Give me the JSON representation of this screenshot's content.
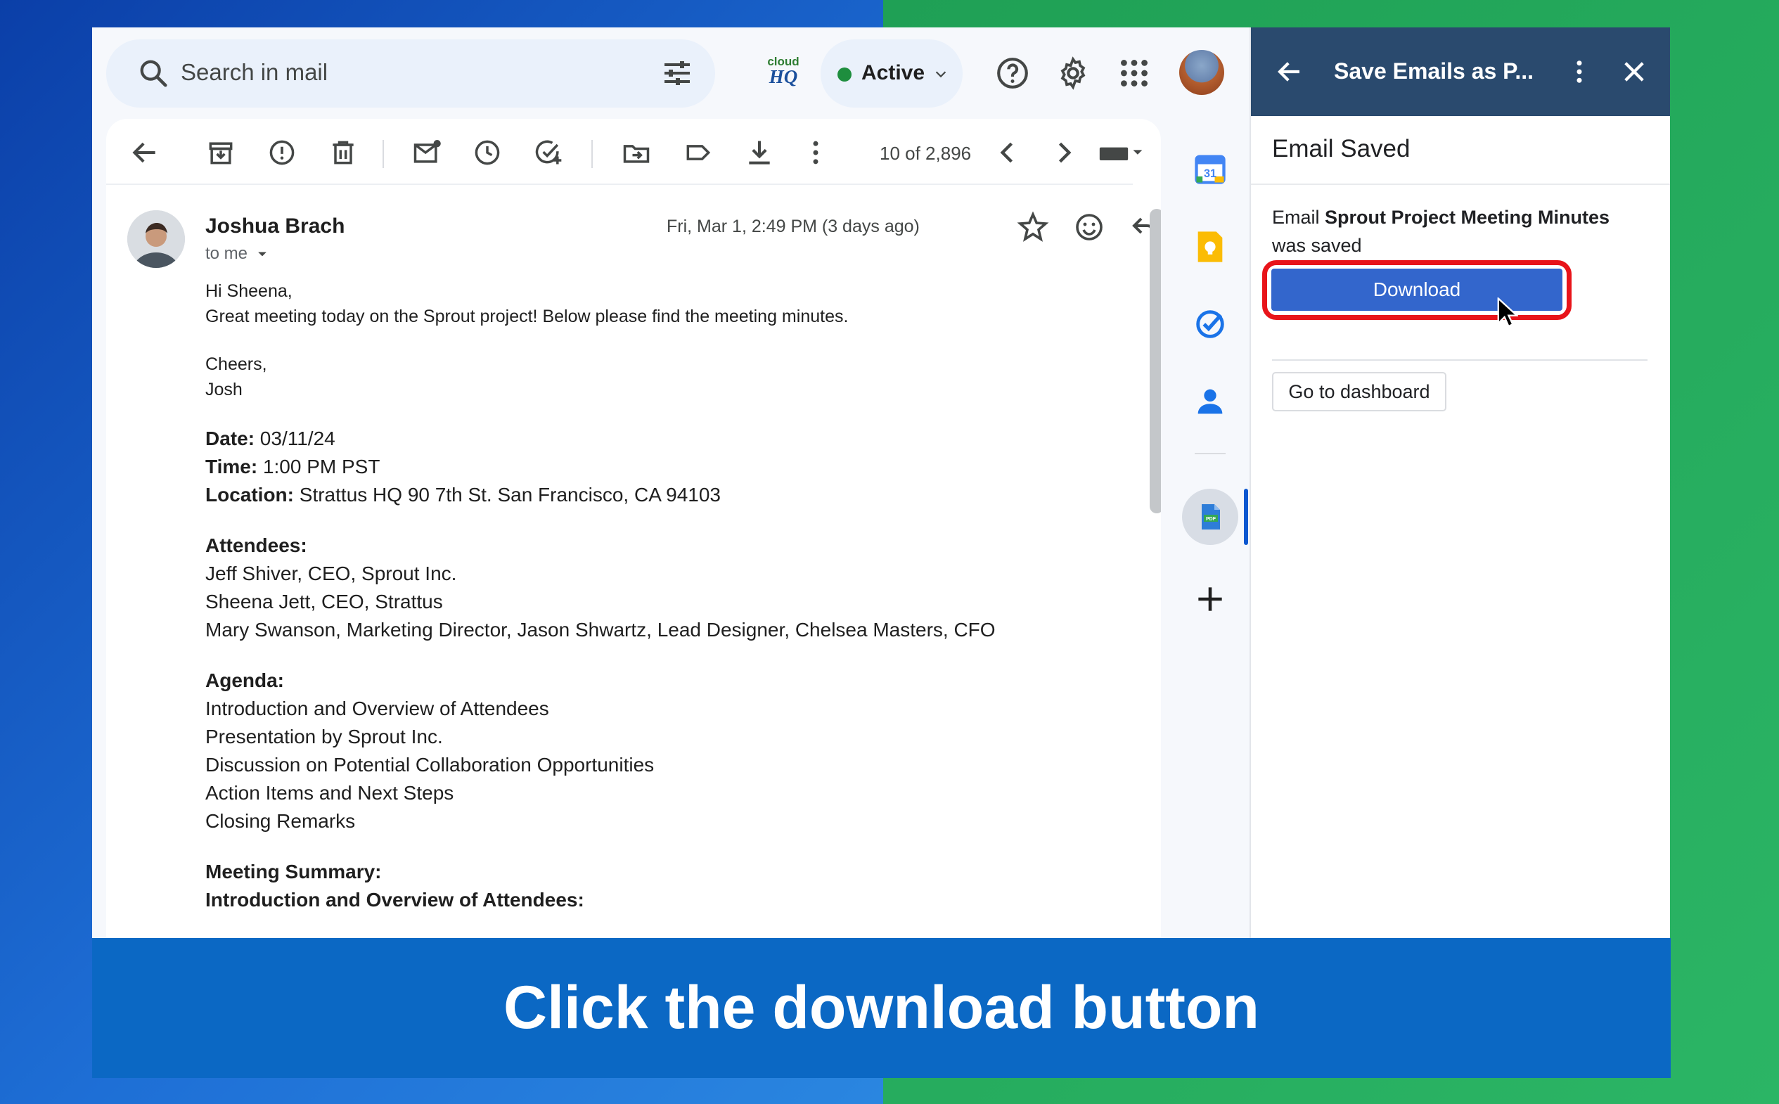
{
  "search": {
    "placeholder": "Search in mail"
  },
  "cloudhq": {
    "top": "cloud",
    "bottom": "HQ"
  },
  "status": {
    "label": "Active",
    "color": "#1e8e3e"
  },
  "toolbar": {
    "count": "10 of 2,896"
  },
  "email": {
    "sender": "Joshua Brach",
    "to": "to me",
    "date": "Fri, Mar 1, 2:49 PM (3 days ago)",
    "greeting": "Hi Sheena,",
    "intro": "Great meeting today on the Sprout project! Below please find the meeting minutes.",
    "signoff": "Cheers,",
    "signature": "Josh",
    "date_label": "Date:",
    "date_value": " 03/11/24",
    "time_label": "Time:",
    "time_value": " 1:00 PM PST",
    "location_label": "Location:",
    "location_value": " Strattus HQ 90 7th St. San Francisco, CA 94103",
    "attendees_label": "Attendees:",
    "attendees": [
      "Jeff Shiver, CEO, Sprout Inc.",
      "Sheena Jett, CEO, Strattus",
      "Mary Swanson, Marketing Director, Jason Shwartz, Lead Designer, Chelsea Masters, CFO"
    ],
    "agenda_label": "Agenda:",
    "agenda": [
      "Introduction and Overview of Attendees",
      "Presentation by Sprout Inc.",
      "Discussion on Potential Collaboration Opportunities",
      "Action Items and Next Steps",
      "Closing Remarks"
    ],
    "summary_label": "Meeting Summary:",
    "summary_sub": "Introduction and Overview of Attendees:"
  },
  "panel": {
    "title": "Save Emails as P...",
    "subtitle": "Email Saved",
    "msg_prefix": "Email ",
    "msg_name": "Sprout Project Meeting Minutes",
    "msg_suffix": "was saved",
    "download": "Download",
    "dashboard": "Go to dashboard",
    "header_color": "#2a4a6e",
    "button_color": "#3366cc",
    "highlight_color": "#e8141a"
  },
  "caption": "Click the download button"
}
